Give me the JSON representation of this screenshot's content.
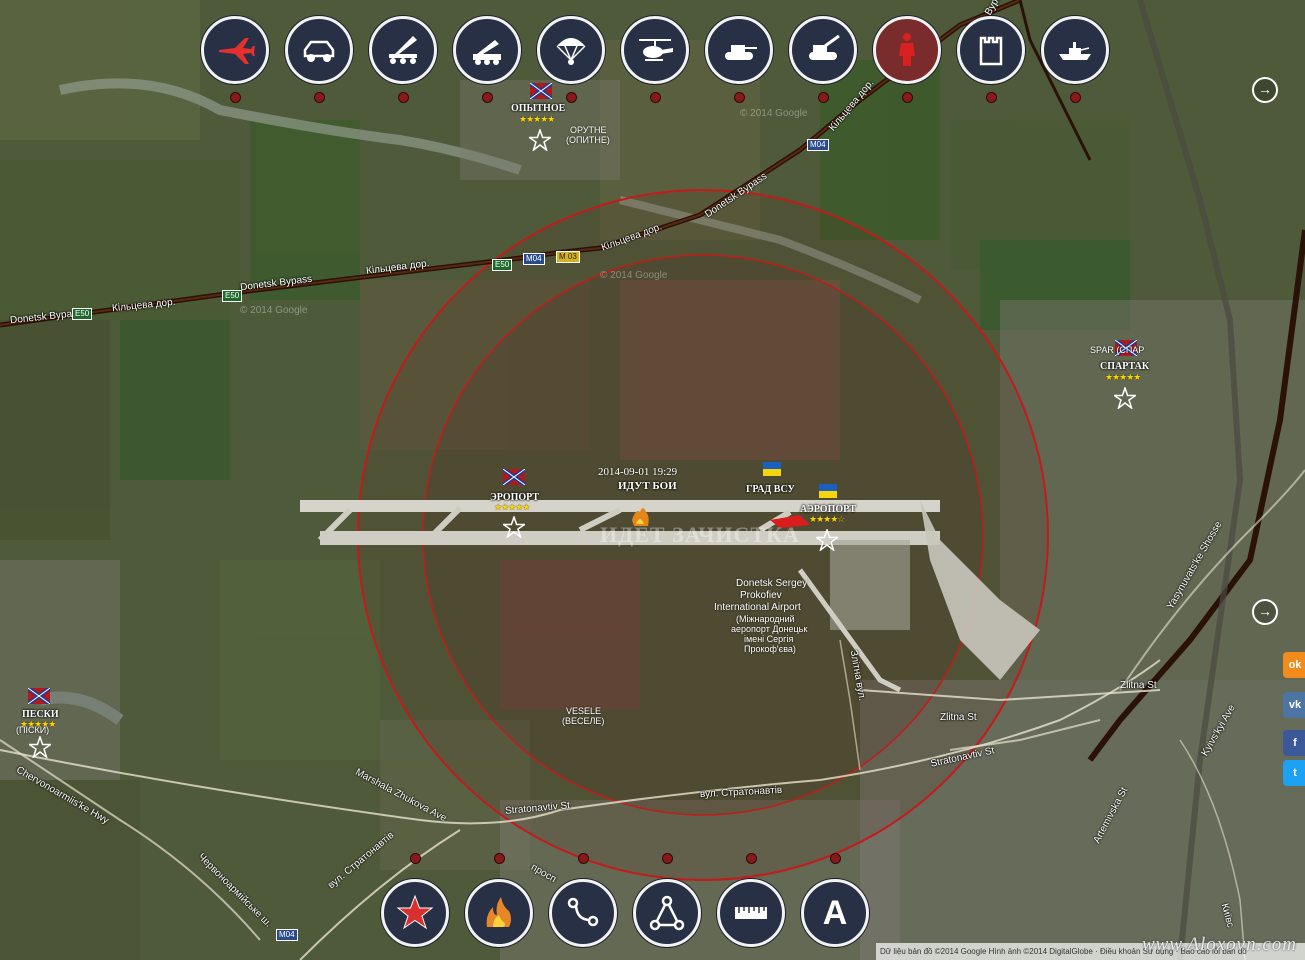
{
  "top_toolbar": [
    {
      "name": "jet",
      "icon": "fighter-jet-icon"
    },
    {
      "name": "car",
      "icon": "armored-car-icon"
    },
    {
      "name": "mlrs",
      "icon": "rocket-launcher-icon"
    },
    {
      "name": "sam",
      "icon": "missile-system-icon"
    },
    {
      "name": "para",
      "icon": "parachute-icon"
    },
    {
      "name": "heli",
      "icon": "helicopter-icon"
    },
    {
      "name": "tank",
      "icon": "tank-icon"
    },
    {
      "name": "artillery",
      "icon": "artillery-icon"
    },
    {
      "name": "soldier",
      "icon": "soldier-icon",
      "active": true
    },
    {
      "name": "fort",
      "icon": "fortification-icon"
    },
    {
      "name": "ship",
      "icon": "warship-icon"
    }
  ],
  "bottom_toolbar": [
    {
      "name": "star",
      "icon": "star-icon"
    },
    {
      "name": "fire",
      "icon": "fire-icon"
    },
    {
      "name": "route",
      "icon": "route-icon"
    },
    {
      "name": "triangle",
      "icon": "triangle-nodes-icon"
    },
    {
      "name": "ruler",
      "icon": "ruler-icon"
    },
    {
      "name": "text",
      "icon": "text-tool-icon",
      "label": "A"
    }
  ],
  "places": {
    "opytnoe": {
      "label": "ОПЫТНОЕ",
      "stars": "★★★★★",
      "sub1": "ОРУТНЕ",
      "sub2": "(ОПИТНЕ)"
    },
    "spartak": {
      "label": "СПАРТАК",
      "stars": "★★★★★",
      "sub": "SPAR (СПАР"
    },
    "peski": {
      "label": "ПЕСКИ",
      "stars": "★★★★★",
      "sub": "(ПІСКИ)"
    },
    "airport_west": {
      "label": "ЭРОПОРТ",
      "stars": "★★★★★"
    },
    "airport_east": {
      "label": "АЭРОПОРТ",
      "stars": "★★★★☆"
    },
    "grad": {
      "label": "ГРАД ВСУ"
    },
    "fight": {
      "time": "2014-09-01 19:29",
      "label": "ИДУТ БОИ"
    },
    "clearing": {
      "label": "ИДЕТ ЗАЧИСТКА"
    },
    "airport_name": {
      "l1": "Donetsk Sergey",
      "l2": "Prokofiev",
      "l3": "International Airport",
      "l4": "(Міжнародний",
      "l5": "аеропорт Донецьк",
      "l6": "імені Сергія",
      "l7": "Прокоф'єва)"
    },
    "vesele": {
      "l1": "VESELE",
      "l2": "(ВЕСЕЛЕ)"
    }
  },
  "roads": {
    "bypass1": "Donetsk Bypass",
    "bypass2": "Кільцева дор.",
    "bypass3": "Donetsk Bypass",
    "bypass4": "Кільцева дор.",
    "bypass5": "Кільцева дор.",
    "bypass6": "Donetsk Bypass",
    "bypass7": "Кільцева дор.",
    "bypass8": "Donetsk Bypa",
    "zlitna1": "Zlitna St",
    "zlitna2": "Zlitna St",
    "stratonavtiv1": "Stratonavtiv St",
    "stratonavtiv2": "вул. Стратонавтів",
    "stratonavtiv3": "Stratonavtiv St",
    "stratonavtiv4": "вул. Стратонавтів",
    "zhukova": "Marshala Zhukova Ave",
    "chervonoarm": "Chervonoarmiis'ke Hwy",
    "chervonoarm_ua": "Червоноармійське ш.",
    "yasynuvats": "Yasynuvats'ke Shosse",
    "kyivs": "Kyivs'kyi Ave",
    "artemivska": "Artemivska St",
    "kyivs2": "Київс",
    "prosp": "просп",
    "liptna": "Злітна вул.",
    "e50a": "E50",
    "e50b": "E50",
    "e50c": "E50",
    "m04a": "M04",
    "m04b": "M04",
    "m04c": "M04",
    "m03": "M 03"
  },
  "attribution": "Dữ liệu bản đồ ©2014 Google Hình ảnh ©2014 DigitalGlobe · Điều khoản Sử dụng · Báo cáo lỗi bản đồ",
  "watermark": "www.Aloxovn.com",
  "google_watermark": "© 2014 Google",
  "social": [
    {
      "name": "odnoklassniki",
      "label": "ok",
      "color": "#f28b1c"
    },
    {
      "name": "vkontakte",
      "label": "vk",
      "color": "#4c75a3"
    },
    {
      "name": "facebook",
      "label": "f",
      "color": "#3b5998"
    },
    {
      "name": "twitter",
      "label": "t",
      "color": "#1da1f2"
    }
  ],
  "colors": {
    "toolbar_bg": "#283045",
    "marker_dot": "#8a1a1a",
    "circle": "#c41a1a",
    "bypass_road": "#3a1a0a"
  }
}
